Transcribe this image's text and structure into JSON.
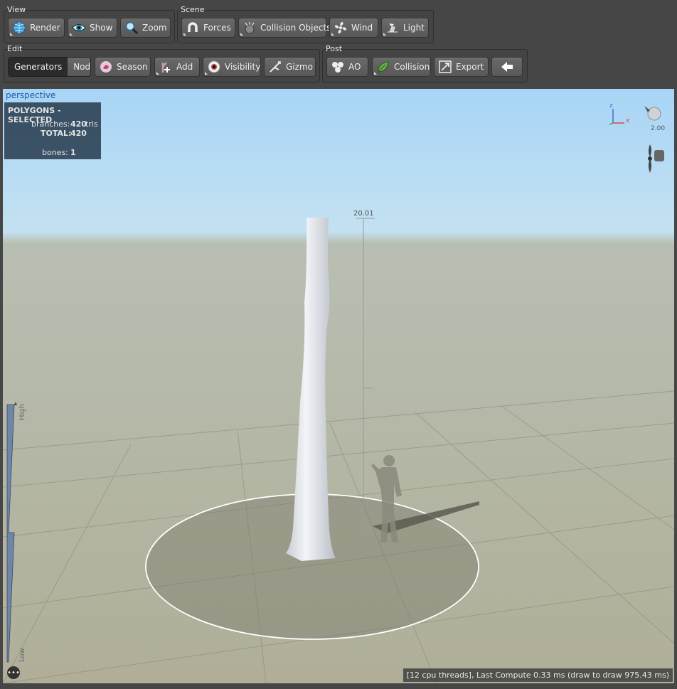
{
  "groups": {
    "view": "View",
    "scene": "Scene",
    "edit": "Edit",
    "post": "Post"
  },
  "view_buttons": [
    "Render",
    "Show",
    "Zoom"
  ],
  "scene_buttons": [
    "Forces",
    "Collision Objects",
    "Wind",
    "Light"
  ],
  "edit_segment": [
    "Generators",
    "Nodes"
  ],
  "edit_buttons": [
    "Season",
    "Add",
    "Visibility",
    "Gizmo"
  ],
  "post_buttons": [
    "AO",
    "Collision",
    "Export"
  ],
  "viewport": {
    "camera": "perspective",
    "stats_title": "POLYGONS - SELECTED",
    "branches_label": "branches:",
    "branches_value": "420",
    "branches_unit": "tris",
    "total_label": "TOTAL:",
    "total_value": "420",
    "bones_label": "bones:",
    "bones_value": "1",
    "scale_value": "20.01",
    "light_intensity": "2.00",
    "axis_z": "z",
    "axis_x": "x",
    "lod_high": "High",
    "lod_low": "Low",
    "status": "[12 cpu threads], Last Compute 0.33 ms (draw to draw 975.43 ms)"
  },
  "colors": {
    "accent": "#1d5aa8",
    "sky": "#a8d5f6",
    "ground": "#b0ae98"
  },
  "icons": [
    "globe-icon",
    "eye-icon",
    "magnifier-icon",
    "magnet-icon",
    "collision-icon",
    "fan-icon",
    "lamp-icon",
    "season-icon",
    "add-icon",
    "eyeball-icon",
    "gizmo-icon",
    "ao-icon",
    "leaf-icon",
    "export-icon",
    "arrow-left-icon",
    "light-bulb-icon",
    "fan-gizmo-icon",
    "more-icon"
  ]
}
